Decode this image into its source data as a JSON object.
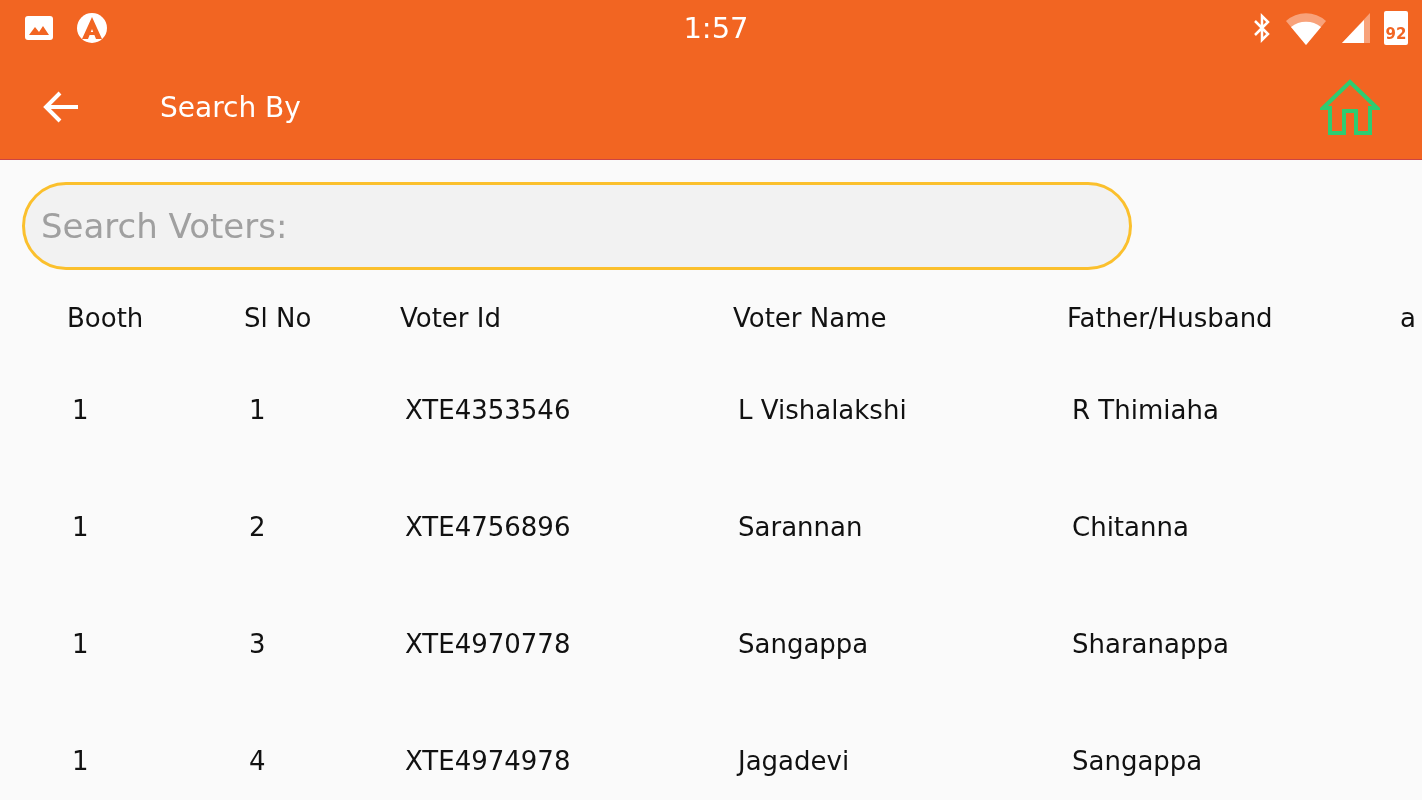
{
  "status_bar": {
    "time": "1:57",
    "battery": "92"
  },
  "toolbar": {
    "title": "Search By"
  },
  "search": {
    "placeholder": "Search Voters:"
  },
  "table": {
    "columns": [
      "Booth",
      "Sl No",
      "Voter Id",
      "Voter Name",
      "Father/Husband",
      "a"
    ],
    "rows": [
      {
        "booth": "1",
        "sl_no": "1",
        "voter_id": "XTE4353546",
        "voter_name": "L Vishalakshi",
        "father_husband": "R Thimiaha"
      },
      {
        "booth": "1",
        "sl_no": "2",
        "voter_id": "XTE4756896",
        "voter_name": "Sarannan",
        "father_husband": "Chitanna"
      },
      {
        "booth": "1",
        "sl_no": "3",
        "voter_id": "XTE4970778",
        "voter_name": "Sangappa",
        "father_husband": "Sharanappa"
      },
      {
        "booth": "1",
        "sl_no": "4",
        "voter_id": "XTE4974978",
        "voter_name": "Jagadevi",
        "father_husband": "Sangappa"
      }
    ]
  }
}
